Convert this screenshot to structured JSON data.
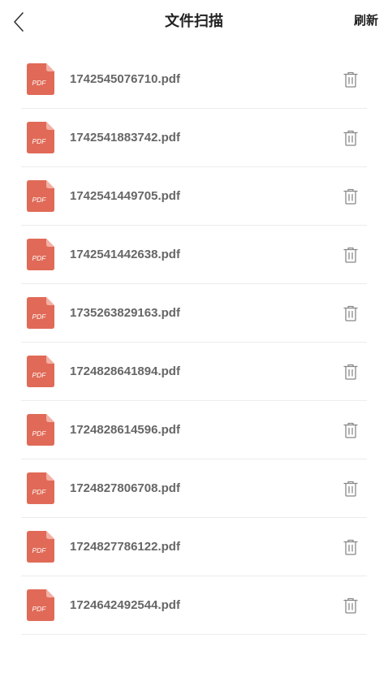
{
  "header": {
    "back_icon": "chevron-left-icon",
    "title": "文件扫描",
    "refresh_label": "刷新"
  },
  "file_icon": {
    "name": "pdf-file-icon",
    "label": "PDF",
    "color": "#e06a57"
  },
  "delete_icon": "trash-icon",
  "files": [
    {
      "name": "1742545076710.pdf"
    },
    {
      "name": "1742541883742.pdf"
    },
    {
      "name": "1742541449705.pdf"
    },
    {
      "name": "1742541442638.pdf"
    },
    {
      "name": "1735263829163.pdf"
    },
    {
      "name": "1724828641894.pdf"
    },
    {
      "name": "1724828614596.pdf"
    },
    {
      "name": "1724827806708.pdf"
    },
    {
      "name": "1724827786122.pdf"
    },
    {
      "name": "1724642492544.pdf"
    }
  ]
}
